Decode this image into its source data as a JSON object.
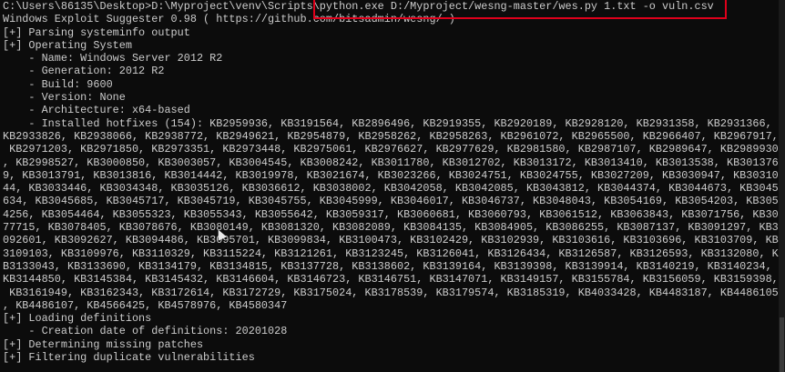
{
  "terminal": {
    "lines": [
      "C:\\Users\\86135\\Desktop>D:\\Myproject\\venv\\Scripts\\python.exe D:/Myproject/wesng-master/wes.py 1.txt -o vuln.csv",
      "Windows Exploit Suggester 0.98 ( https://github.com/bitsadmin/wesng/ )",
      "[+] Parsing systeminfo output",
      "[+] Operating System",
      "    - Name: Windows Server 2012 R2",
      "    - Generation: 2012 R2",
      "    - Build: 9600",
      "    - Version: None",
      "    - Architecture: x64-based",
      "    - Installed hotfixes (154): KB2959936, KB3191564, KB2896496, KB2919355, KB2920189, KB2928120, KB2931358, KB2931366,",
      "KB2933826, KB2938066, KB2938772, KB2949621, KB2954879, KB2958262, KB2958263, KB2961072, KB2965500, KB2966407, KB2967917,",
      " KB2971203, KB2971850, KB2973351, KB2973448, KB2975061, KB2976627, KB2977629, KB2981580, KB2987107, KB2989647, KB2989930",
      ", KB2998527, KB3000850, KB3003057, KB3004545, KB3008242, KB3011780, KB3012702, KB3013172, KB3013410, KB3013538, KB301376",
      "9, KB3013791, KB3013816, KB3014442, KB3019978, KB3021674, KB3023266, KB3024751, KB3024755, KB3027209, KB3030947, KB30310",
      "44, KB3033446, KB3034348, KB3035126, KB3036612, KB3038002, KB3042058, KB3042085, KB3043812, KB3044374, KB3044673, KB3045",
      "634, KB3045685, KB3045717, KB3045719, KB3045755, KB3045999, KB3046017, KB3046737, KB3048043, KB3054169, KB3054203, KB305",
      "4256, KB3054464, KB3055323, KB3055343, KB3055642, KB3059317, KB3060681, KB3060793, KB3061512, KB3063843, KB3071756, KB30",
      "77715, KB3078405, KB3078676, KB3080149, KB3081320, KB3082089, KB3084135, KB3084905, KB3086255, KB3087137, KB3091297, KB3",
      "092601, KB3092627, KB3094486, KB3095701, KB3099834, KB3100473, KB3102429, KB3102939, KB3103616, KB3103696, KB3103709, KB",
      "3109103, KB3109976, KB3110329, KB3115224, KB3121261, KB3123245, KB3126041, KB3126434, KB3126587, KB3126593, KB3132080, K",
      "B3133043, KB3133690, KB3134179, KB3134815, KB3137728, KB3138602, KB3139164, KB3139398, KB3139914, KB3140219, KB3140234,",
      "KB3144850, KB3145384, KB3145432, KB3146604, KB3146723, KB3146751, KB3147071, KB3149157, KB3155784, KB3156059, KB3159398,",
      " KB3161949, KB3162343, KB3172614, KB3172729, KB3175024, KB3178539, KB3179574, KB3185319, KB4033428, KB4483187, KB4486105",
      ", KB4486107, KB4566425, KB4578976, KB4580347",
      "[+] Loading definitions",
      "    - Creation date of definitions: 20201028",
      "[+] Determining missing patches",
      "[+] Filtering duplicate vulnerabilities"
    ]
  },
  "colors": {
    "background": "#0c0c0c",
    "text": "#cccccc",
    "highlight_box": "#e0001b"
  }
}
